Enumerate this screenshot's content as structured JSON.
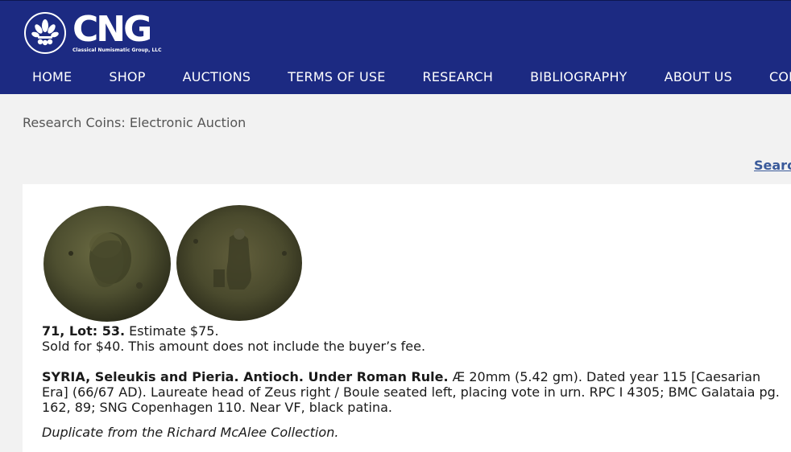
{
  "header": {
    "logo_text": "CNG",
    "logo_subtext": "Classical Numismatic Group, LLC",
    "logo_icon": "fleur-de-lis-icon",
    "nav": [
      {
        "label": "HOME"
      },
      {
        "label": "SHOP"
      },
      {
        "label": "AUCTIONS"
      },
      {
        "label": "TERMS OF USE"
      },
      {
        "label": "RESEARCH"
      },
      {
        "label": "BIBLIOGRAPHY"
      },
      {
        "label": "ABOUT US"
      },
      {
        "label": "CONT"
      }
    ]
  },
  "breadcrumb": "Research Coins: Electronic Auction",
  "search_link": "Searc",
  "lot": {
    "lot_label": "71, Lot: 53.",
    "estimate": "Estimate $75.",
    "sold": "Sold for $40. This amount does not include the buyer’s fee.",
    "title": "SYRIA, Seleukis and Pieria. Antioch. Under Roman Rule.",
    "description": "Æ 20mm (5.42 gm). Dated year 115 [Caesarian Era] (66/67 AD). Laureate head of Zeus right / Boule seated left, placing vote in urn. RPC I 4305; BMC Galataia pg. 162, 89; SNG Copenhagen 110. Near VF, black patina.",
    "note": "Duplicate from the Richard McAlee Collection."
  },
  "colors": {
    "header_bg": "#1c2a82",
    "link": "#3a5a9a"
  }
}
